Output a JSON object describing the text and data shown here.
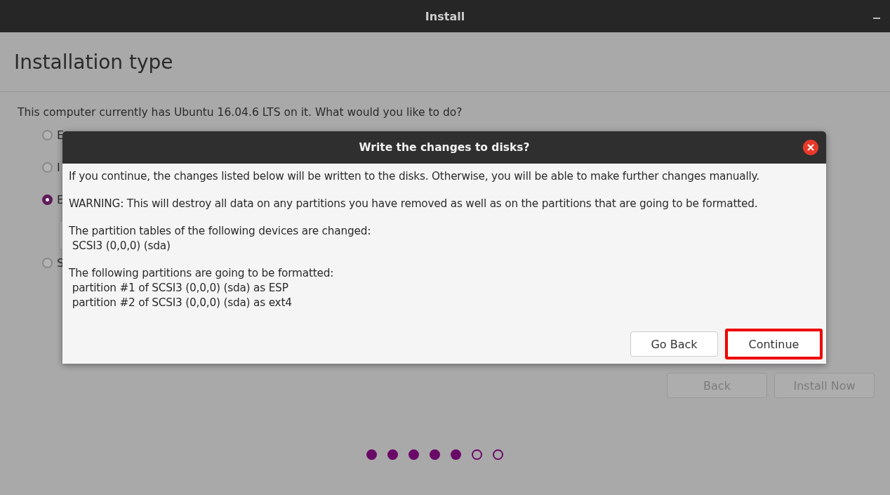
{
  "window": {
    "title": "Install"
  },
  "page": {
    "heading": "Installation type",
    "question": "This computer currently has Ubuntu 16.04.6 LTS on it. What would you like to do?",
    "options": [
      {
        "label": "E",
        "selected": false,
        "has_field": false
      },
      {
        "label": "I",
        "selected": false,
        "has_field": false
      },
      {
        "label": "E",
        "selected": true,
        "has_field": true
      },
      {
        "label": "S",
        "selected": false,
        "has_field": false
      }
    ],
    "buttons": [
      {
        "label": "Back",
        "disabled": true
      },
      {
        "label": "Install Now",
        "disabled": true
      }
    ],
    "progress_dots": [
      {
        "filled": true
      },
      {
        "filled": true
      },
      {
        "filled": true
      },
      {
        "filled": true
      },
      {
        "filled": true
      },
      {
        "filled": false
      },
      {
        "filled": false
      }
    ]
  },
  "dialog": {
    "title": "Write the changes to disks?",
    "paragraphs": [
      {
        "lines": [
          "If you continue, the changes listed below will be written to the disks. Otherwise, you will be able to make further changes manually."
        ]
      },
      {
        "lines": [
          "WARNING: This will destroy all data on any partitions you have removed as well as on the partitions that are going to be formatted."
        ]
      },
      {
        "lines": [
          "The partition tables of the following devices are changed:",
          " SCSI3 (0,0,0) (sda)"
        ]
      },
      {
        "lines": [
          "The following partitions are going to be formatted:",
          " partition #1 of SCSI3 (0,0,0) (sda) as ESP",
          " partition #2 of SCSI3 (0,0,0) (sda) as ext4"
        ]
      }
    ],
    "buttons": [
      {
        "label": "Go Back",
        "highlighted": false
      },
      {
        "label": "Continue",
        "highlighted": true
      }
    ]
  }
}
